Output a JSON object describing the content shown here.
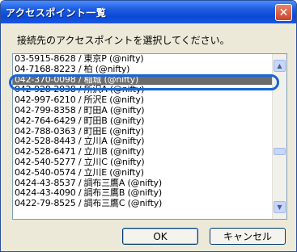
{
  "dialog": {
    "title": "アクセスポイント一覧",
    "close_label": "✕",
    "prompt": "接続先のアクセスポイントを選択してください。",
    "ok_label": "OK",
    "cancel_label": "キャンセル"
  },
  "list": {
    "selected_index": 2,
    "items": [
      "03-5915-8628 / 東京P (@nifty)",
      "04-7168-8223 / 柏 (@nifty)",
      "042-370-0098 / 稲城 (@nifty)",
      "042-928-2038 / 所沢A (@nifty)",
      "042-997-6210 / 所沢E (@nifty)",
      "042-799-8358 / 町田A (@nifty)",
      "042-764-6429 / 町田B (@nifty)",
      "042-788-0363 / 町田E (@nifty)",
      "042-528-8443 / 立川A (@nifty)",
      "042-528-6471 / 立川B (@nifty)",
      "042-540-5277 / 立川C (@nifty)",
      "042-540-0574 / 立川E (@nifty)",
      "0424-43-8537 / 調布三鷹A (@nifty)",
      "0424-43-4090 / 調布三鷹B (@nifty)",
      "0422-79-8525 / 調布三鷹C (@nifty)"
    ]
  },
  "scrollbar": {
    "up_icon": "▲",
    "down_icon": "▼"
  }
}
